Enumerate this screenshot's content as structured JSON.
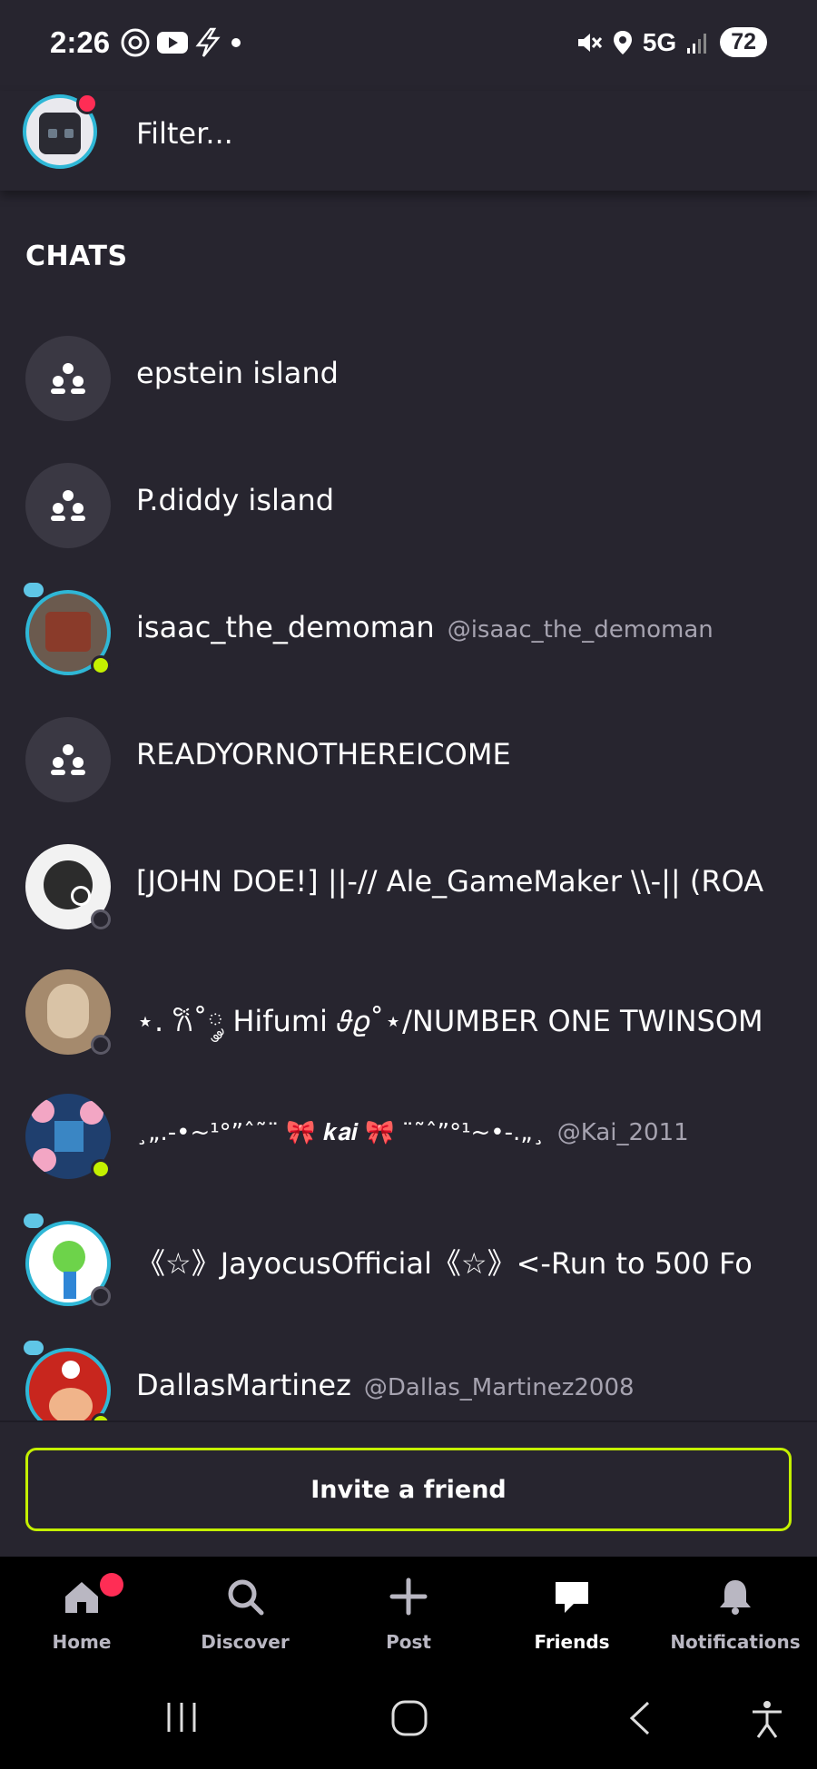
{
  "status_bar": {
    "time": "2:26",
    "network": "5G",
    "battery": "72"
  },
  "header": {
    "filter_placeholder": "Filter..."
  },
  "section_title": "CHATS",
  "chats": [
    {
      "name": "epstein island",
      "handle": "",
      "type": "group"
    },
    {
      "name": "P.diddy island",
      "handle": "",
      "type": "group"
    },
    {
      "name": "isaac_the_demoman",
      "handle": "@isaac_the_demoman",
      "type": "user",
      "status": "online"
    },
    {
      "name": "READYORNOTHEREICOME",
      "handle": "",
      "type": "group"
    },
    {
      "name": "[JOHN DOE!] ||-// Ale_GameMaker \\\\-|| (ROA",
      "handle": "",
      "type": "user",
      "status": "offline"
    },
    {
      "name": "⋆. 𐙚˚༘ Hifumi 𝜗𝜚˚⋆/NUMBER ONE TWINSOM",
      "handle": "",
      "type": "user",
      "status": "offline"
    },
    {
      "name": "¸„.-•~¹°”ˆ˜¨ 🎀 𝒌𝒂𝒊 🎀 ¨˜ˆ”°¹~•-.„¸",
      "handle": "@Kai_2011",
      "type": "user",
      "status": "online"
    },
    {
      "name": "《☆》JayocusOfficial《☆》<-Run to 500 Fo",
      "handle": "",
      "type": "user",
      "status": "offline"
    },
    {
      "name": "DallasMartinez",
      "handle": "@Dallas_Martinez2008",
      "type": "user",
      "status": "online"
    }
  ],
  "invite_label": "Invite a friend",
  "bottom_nav": [
    {
      "label": "Home",
      "icon": "home-icon",
      "badge": true
    },
    {
      "label": "Discover",
      "icon": "search-icon"
    },
    {
      "label": "Post",
      "icon": "plus-icon"
    },
    {
      "label": "Friends",
      "icon": "chat-bubble-icon",
      "active": true
    },
    {
      "label": "Notifications",
      "icon": "bell-icon"
    }
  ],
  "colors": {
    "background": "#27252f",
    "accent": "#c4f000",
    "badge": "#ff2d55",
    "ring": "#2fb7d6"
  }
}
